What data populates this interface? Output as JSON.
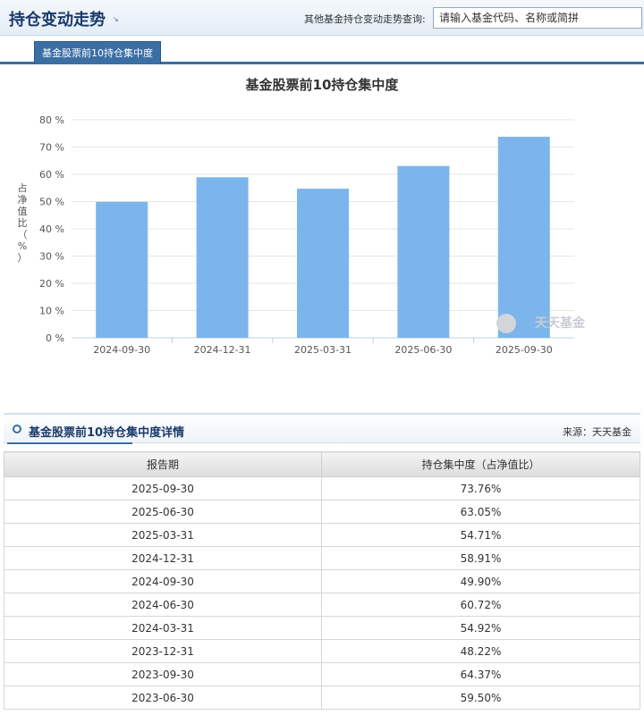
{
  "header": {
    "title": "持仓变动走势",
    "arrow_icon": "arrow-down-right-icon",
    "query_label": "其他基金持仓变动走势查询:",
    "query_placeholder": "请输入基金代码、名称或简拼"
  },
  "tabs": [
    {
      "label": "基金股票前10持仓集中度",
      "active": true
    }
  ],
  "chart_data": {
    "type": "bar",
    "title": "基金股票前10持仓集中度",
    "ylabel": "占净值比（%）",
    "categories": [
      "2024-09-30",
      "2024-12-31",
      "2025-03-31",
      "2025-06-30",
      "2025-09-30"
    ],
    "values": [
      49.9,
      58.91,
      54.71,
      63.05,
      73.76
    ],
    "ylim": [
      0,
      80
    ],
    "yticks": [
      0,
      10,
      20,
      30,
      40,
      50,
      60,
      70,
      80
    ],
    "ytick_suffix": " %",
    "grid": true,
    "bar_color": "#7cb5ec",
    "watermark": "天天基金"
  },
  "detail": {
    "title": "基金股票前10持仓集中度详情",
    "source": "来源：天天基金",
    "columns": [
      "报告期",
      "持仓集中度（占净值比）"
    ],
    "rows": [
      [
        "2025-09-30",
        "73.76%"
      ],
      [
        "2025-06-30",
        "63.05%"
      ],
      [
        "2025-03-31",
        "54.71%"
      ],
      [
        "2024-12-31",
        "58.91%"
      ],
      [
        "2024-09-30",
        "49.90%"
      ],
      [
        "2024-06-30",
        "60.72%"
      ],
      [
        "2024-03-31",
        "54.92%"
      ],
      [
        "2023-12-31",
        "48.22%"
      ],
      [
        "2023-09-30",
        "64.37%"
      ],
      [
        "2023-06-30",
        "59.50%"
      ]
    ]
  }
}
